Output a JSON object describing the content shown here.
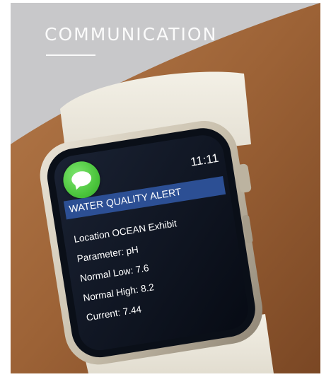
{
  "page": {
    "section_title": "COMMUNICATION"
  },
  "watch": {
    "time": "11:11",
    "app_icon": "messages-icon",
    "alert_title": "WATER QUALITY ALERT",
    "details": [
      "Location OCEAN Exhibit",
      "Parameter: pH",
      "Normal Low: 7.6",
      "Normal High: 8.2",
      "Current: 7.44"
    ]
  },
  "colors": {
    "alert_bar": "#2c4f94",
    "icon_green": "#4cc53d",
    "screen_bg": "#0d1320"
  }
}
